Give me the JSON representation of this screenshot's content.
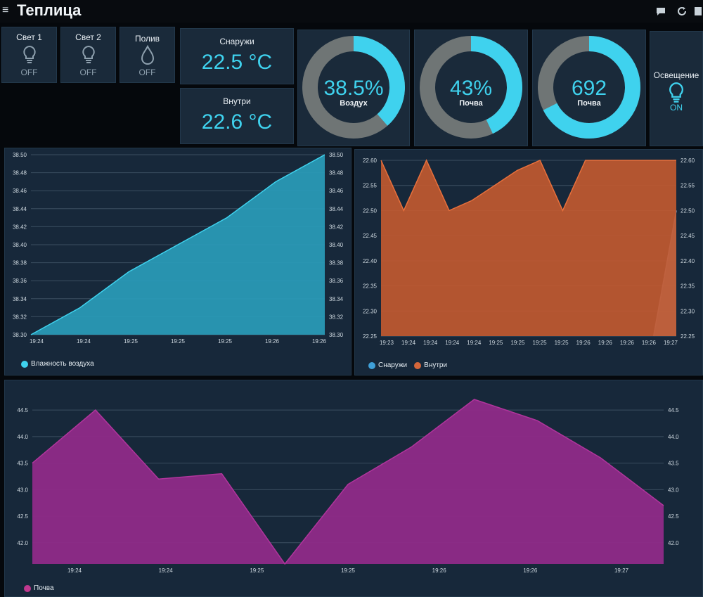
{
  "app": {
    "title": "Теплица"
  },
  "toggles": [
    {
      "label": "Свет 1",
      "state": "OFF",
      "icon": "bulb-icon"
    },
    {
      "label": "Свет 2",
      "state": "OFF",
      "icon": "bulb-icon"
    },
    {
      "label": "Полив",
      "state": "OFF",
      "icon": "water-drop-icon"
    }
  ],
  "temps": [
    {
      "label": "Снаружи",
      "value": "22.5 °C"
    },
    {
      "label": "Внутри",
      "value": "22.6 °C"
    }
  ],
  "gauges": [
    {
      "label": "Воздух",
      "value": "38.5%",
      "fraction": 0.385
    },
    {
      "label": "Почва",
      "value": "43%",
      "fraction": 0.43
    },
    {
      "label": "Почва",
      "value": "692",
      "fraction": 0.676
    }
  ],
  "lighting": {
    "label": "Освещение",
    "state": "ON",
    "icon": "bulb-icon"
  },
  "colors": {
    "accent": "#3fd2ee",
    "gauge_track": "#6f7575",
    "humidity_fill": "#2a9fbd",
    "outside_series": "#3fa0d8",
    "inside_series": "#d4663a",
    "soil_series": "#8f2a88",
    "panel": "#1a2a3a"
  },
  "chart_data": [
    {
      "type": "area",
      "x": [
        "19:24",
        "19:24",
        "19:25",
        "19:25",
        "19:25",
        "19:26",
        "19:26"
      ],
      "series": [
        {
          "name": "Влажность воздуха",
          "values": [
            38.3,
            38.33,
            38.37,
            38.4,
            38.43,
            38.47,
            38.5
          ]
        }
      ],
      "yticks": [
        "38.50",
        "38.48",
        "38.46",
        "38.44",
        "38.42",
        "38.40",
        "38.38",
        "38.36",
        "38.34",
        "38.32",
        "38.30"
      ],
      "ylim": [
        38.3,
        38.5
      ],
      "grid": true,
      "legend": "bottom-left"
    },
    {
      "type": "area",
      "x": [
        "19:23",
        "19:24",
        "19:24",
        "19:24",
        "19:24",
        "19:25",
        "19:25",
        "19:25",
        "19:25",
        "19:26",
        "19:26",
        "19:26",
        "19:26",
        "19:27"
      ],
      "series": [
        {
          "name": "Снаружи",
          "values": [
            null,
            null,
            null,
            null,
            null,
            null,
            null,
            null,
            null,
            null,
            null,
            null,
            22.25,
            22.5
          ]
        },
        {
          "name": "Внутри",
          "values": [
            22.6,
            22.5,
            22.6,
            22.5,
            22.52,
            22.55,
            22.58,
            22.6,
            22.5,
            22.6,
            22.6,
            22.6,
            22.6,
            22.6
          ]
        }
      ],
      "yticks": [
        "22.60",
        "22.55",
        "22.50",
        "22.45",
        "22.40",
        "22.35",
        "22.30",
        "22.25"
      ],
      "ylim": [
        22.25,
        22.6
      ],
      "grid": true,
      "legend": "bottom-left"
    },
    {
      "type": "area",
      "x": [
        "19:24",
        "19:24",
        "19:25",
        "19:25",
        "19:26",
        "19:26",
        "19:27"
      ],
      "series": [
        {
          "name": "Почва",
          "values": [
            43.5,
            44.5,
            43.2,
            43.3,
            41.6,
            43.1,
            43.8,
            44.7,
            44.3,
            43.6,
            42.7
          ]
        }
      ],
      "yticks": [
        "44.5",
        "44.0",
        "43.5",
        "43.0",
        "42.5",
        "42.0"
      ],
      "ylim": [
        41.6,
        44.7
      ],
      "grid": true,
      "legend": "bottom-left"
    }
  ]
}
